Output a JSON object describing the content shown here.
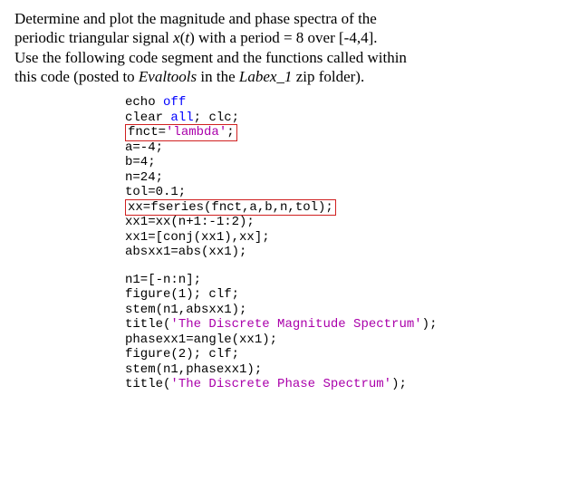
{
  "prose": {
    "l1a": "Determine and plot the magnitude and phase spectra of the",
    "l2a": "periodic triangular signal ",
    "l2b": "x",
    "l2c": "(",
    "l2d": "t",
    "l2e": ") with a period = 8 over [-4,4].",
    "l3a": "Use the following code segment and the functions called within",
    "l4a": "this code (posted to ",
    "l4b": "Evaltools",
    "l4c": " in the ",
    "l4d": "Labex_1",
    "l4e": " zip folder)."
  },
  "code": {
    "t": {
      "echo": "echo",
      "off": "off",
      "clear": "clear",
      "all": "all",
      "semi": ";",
      "sp": " ",
      "clc": "clc",
      "fnct": "fnct=",
      "lambda": "'lambda'",
      "a": "a=-4;",
      "b": "b=4;",
      "n": "n=24;",
      "tol": "tol=0.1;",
      "fseries": "xx=fseries(fnct,a,b,n,tol);",
      "xx1a": "xx1=xx(n+1:-1:2);",
      "xx1b": "xx1=[conj(xx1),xx];",
      "absxx1": "absxx1=abs(xx1);",
      "n1": "n1=[-n:n];",
      "fig1a": "figure(1); ",
      "fig1b": "clf",
      "stem1": "stem(n1,absxx1);",
      "title1a": "title(",
      "title1b": "'The Discrete Magnitude Spectrum'",
      "title1c": ");",
      "phase": "phasexx1=angle(xx1);",
      "fig2a": "figure(2); ",
      "fig2b": "clf",
      "stem2": "stem(n1,phasexx1);",
      "title2a": "title(",
      "title2b": "'The Discrete Phase Spectrum'",
      "title2c": ");"
    }
  }
}
